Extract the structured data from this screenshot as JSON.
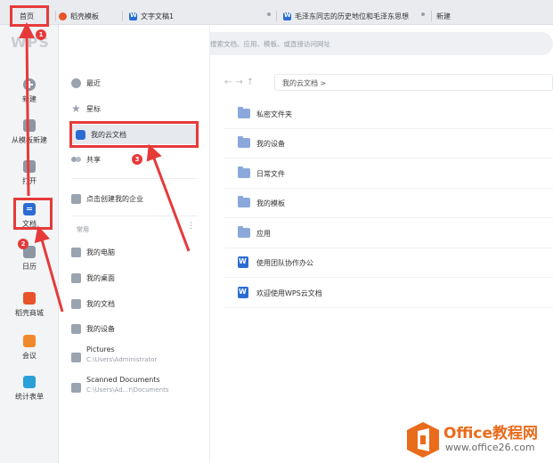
{
  "tabs": [
    {
      "label": "首页",
      "icon": "none"
    },
    {
      "label": "稻壳模板",
      "icon": "shell-icon"
    },
    {
      "label": "文字文稿1",
      "icon": "word-icon"
    },
    {
      "label": "毛泽东同志的历史地位和毛泽东思想",
      "icon": "word-icon"
    },
    {
      "label": "新建",
      "icon": "none"
    }
  ],
  "logo": "WPS",
  "search": {
    "placeholder": "搜索文档、应用、模板、或直接访问网址"
  },
  "leftnav": [
    {
      "label": "新建",
      "icon": "plus-circle-icon"
    },
    {
      "label": "从模板新建",
      "icon": "template-icon"
    },
    {
      "label": "打开",
      "icon": "folder-open-icon"
    },
    {
      "label": "文档",
      "icon": "document-icon"
    },
    {
      "label": "日历",
      "icon": "calendar-icon"
    },
    {
      "label": "稻壳商城",
      "icon": "shell-store-icon"
    },
    {
      "label": "会议",
      "icon": "meeting-icon"
    },
    {
      "label": "统计表单",
      "icon": "form-icon"
    }
  ],
  "panel": {
    "items": [
      {
        "label": "最近",
        "icon": "clock-icon"
      },
      {
        "label": "星标",
        "icon": "star-icon"
      },
      {
        "label": "我的云文档",
        "icon": "cloud-doc-icon"
      },
      {
        "label": "共享",
        "icon": "share-icon"
      },
      {
        "label": "点击创建我的企业",
        "icon": "enterprise-icon"
      }
    ],
    "section_common": "常用",
    "common": [
      {
        "label": "我的电脑",
        "icon": "computer-icon"
      },
      {
        "label": "我的桌面",
        "icon": "desktop-icon"
      },
      {
        "label": "我的文档",
        "icon": "documents-icon"
      },
      {
        "label": "我的设备",
        "icon": "device-icon"
      }
    ],
    "paths": [
      {
        "title": "Pictures",
        "path": "C:\\Users\\Administrator"
      },
      {
        "title": "Scanned Documents",
        "path": "C:\\Users\\Ad...r\\Documents"
      }
    ]
  },
  "breadcrumb": "我的云文档 >",
  "files": [
    {
      "label": "私密文件夹",
      "icon": "lock-folder-icon"
    },
    {
      "label": "我的设备",
      "icon": "device-folder-icon"
    },
    {
      "label": "日常文件",
      "icon": "folder-icon"
    },
    {
      "label": "我的模板",
      "icon": "folder-icon"
    },
    {
      "label": "应用",
      "icon": "folder-icon"
    },
    {
      "label": "使用团队协作办公",
      "icon": "word-doc-icon"
    },
    {
      "label": "欢迎使用WPS云文档",
      "icon": "word-doc-icon"
    }
  ],
  "badges": [
    "1",
    "2",
    "3"
  ],
  "watermark": {
    "title": "Office教程网",
    "url": "www.office26.com"
  },
  "colors": {
    "accent": "#2b6cd3",
    "annotation": "#e63a3a",
    "watermark": "#ea6b1b"
  }
}
